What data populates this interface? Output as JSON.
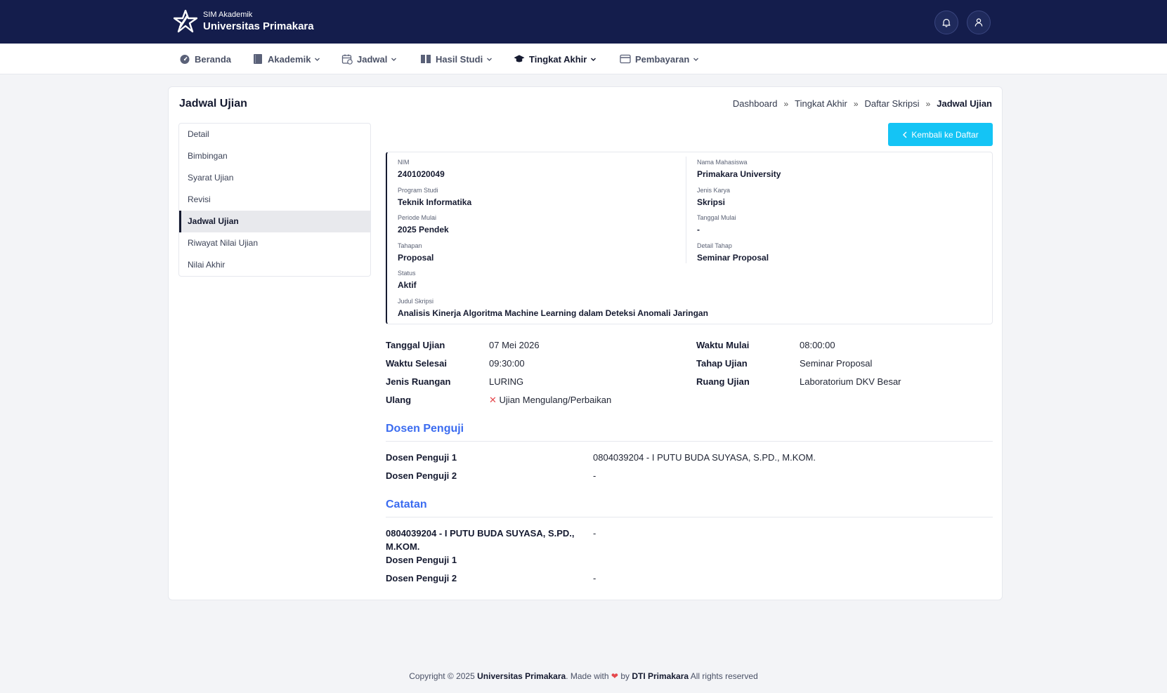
{
  "header": {
    "app_subtitle": "SIM Akademik",
    "university": "Universitas Primakara"
  },
  "nav": {
    "items": [
      {
        "label": "Beranda",
        "icon": "dashboard-icon"
      },
      {
        "label": "Akademik",
        "icon": "book-icon"
      },
      {
        "label": "Jadwal",
        "icon": "calendar-icon"
      },
      {
        "label": "Hasil Studi",
        "icon": "notebook-icon"
      },
      {
        "label": "Tingkat Akhir",
        "icon": "graduation-cap-icon"
      },
      {
        "label": "Pembayaran",
        "icon": "payment-card-icon"
      }
    ]
  },
  "page": {
    "title": "Jadwal Ujian",
    "breadcrumbs": [
      "Dashboard",
      "Tingkat Akhir",
      "Daftar Skripsi",
      "Jadwal Ujian"
    ],
    "back_button": "Kembali ke Daftar"
  },
  "sidemenu": {
    "items": [
      "Detail",
      "Bimbingan",
      "Syarat Ujian",
      "Revisi",
      "Jadwal Ujian",
      "Riwayat Nilai Ujian",
      "Nilai Akhir"
    ]
  },
  "info": {
    "nim": {
      "label": "NIM",
      "value": "2401020049"
    },
    "nama": {
      "label": "Nama Mahasiswa",
      "value": "Primakara University"
    },
    "prodi": {
      "label": "Program Studi",
      "value": "Teknik Informatika"
    },
    "jenis_karya": {
      "label": "Jenis Karya",
      "value": "Skripsi"
    },
    "periode": {
      "label": "Periode Mulai",
      "value": "2025 Pendek"
    },
    "tanggal_mulai": {
      "label": "Tanggal Mulai",
      "value": "-"
    },
    "tahapan": {
      "label": "Tahapan",
      "value": "Proposal"
    },
    "detail_tahap": {
      "label": "Detail Tahap",
      "value": "Seminar Proposal"
    },
    "status": {
      "label": "Status",
      "value": "Aktif"
    },
    "judul": {
      "label": "Judul Skripsi",
      "value": "Analisis Kinerja Algoritma Machine Learning dalam Deteksi Anomali Jaringan"
    }
  },
  "exam": {
    "tanggal_ujian": {
      "label": "Tanggal Ujian",
      "value": "07 Mei 2026"
    },
    "waktu_mulai": {
      "label": "Waktu Mulai",
      "value": "08:00:00"
    },
    "waktu_selesai": {
      "label": "Waktu Selesai",
      "value": "09:30:00"
    },
    "tahap_ujian": {
      "label": "Tahap Ujian",
      "value": "Seminar Proposal"
    },
    "jenis_ruangan": {
      "label": "Jenis Ruangan",
      "value": "LURING"
    },
    "ruang_ujian": {
      "label": "Ruang Ujian",
      "value": "Laboratorium DKV Besar"
    },
    "ulang": {
      "label": "Ulang",
      "value": "Ujian Mengulang/Perbaikan",
      "icon": "cross-icon"
    }
  },
  "dosen_penguji": {
    "title": "Dosen Penguji",
    "rows": [
      {
        "label": "Dosen Penguji 1",
        "value": "0804039204 - I PUTU BUDA SUYASA, S.PD., M.KOM."
      },
      {
        "label": "Dosen Penguji 2",
        "value": "-"
      }
    ]
  },
  "catatan": {
    "title": "Catatan",
    "rows": [
      {
        "name_line1": "0804039204 - I PUTU BUDA SUYASA, S.PD.,",
        "name_line2": "M.KOM.",
        "role": "Dosen Penguji 1",
        "value": "-"
      },
      {
        "role": "Dosen Penguji 2",
        "value": "-"
      }
    ]
  },
  "footer": {
    "prefix": "Copyright © 2025",
    "brand": "Universitas Primakara",
    "made_with": ". Made with",
    "by": "by",
    "org": "DTI Primakara",
    "suffix": "All rights reserved"
  },
  "colors": {
    "topbar": "#141d4c",
    "accent_button": "#14c4f5",
    "section_title": "#3b6cf0",
    "heart": "#e5484d",
    "cross": "#e5484d"
  }
}
